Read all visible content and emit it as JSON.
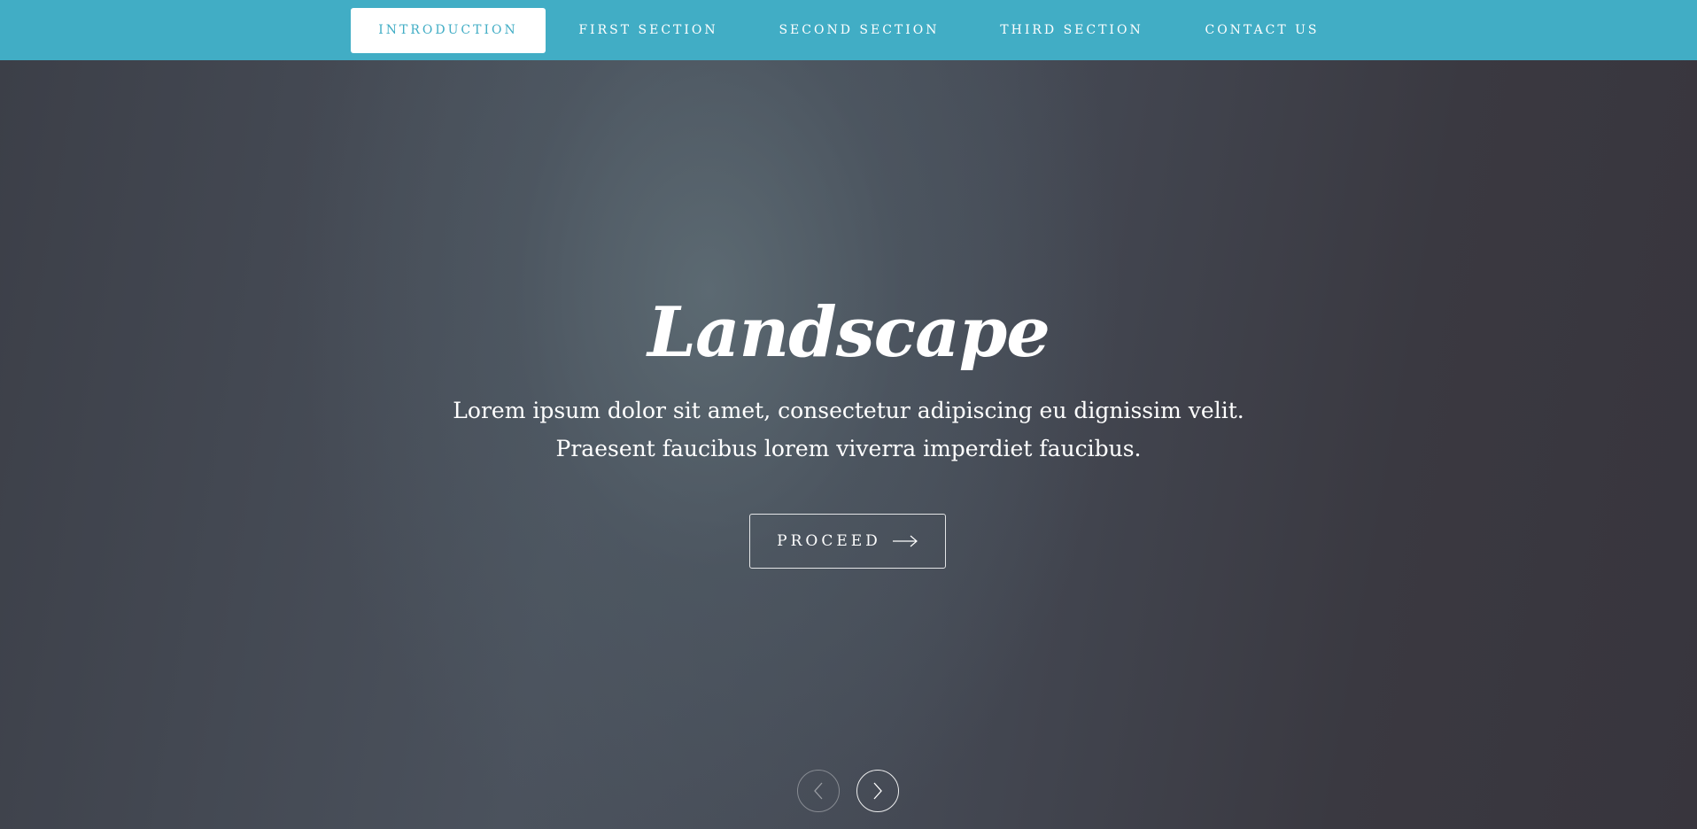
{
  "nav": {
    "items": [
      {
        "label": "INTRODUCTION",
        "active": true
      },
      {
        "label": "FIRST SECTION",
        "active": false
      },
      {
        "label": "SECOND SECTION",
        "active": false
      },
      {
        "label": "THIRD SECTION",
        "active": false
      },
      {
        "label": "CONTACT US",
        "active": false
      }
    ]
  },
  "hero": {
    "title": "Landscape",
    "text": "Lorem ipsum dolor sit amet, consectetur adipiscing eu dignissim velit. Praesent faucibus lorem viverra imperdiet faucibus.",
    "button_label": "PROCEED",
    "button_icon": "arrow-right-icon"
  },
  "slider": {
    "prev_icon": "chevron-left-icon",
    "next_icon": "chevron-right-icon"
  },
  "colors": {
    "accent": "#41adc5",
    "text": "#ffffff"
  }
}
